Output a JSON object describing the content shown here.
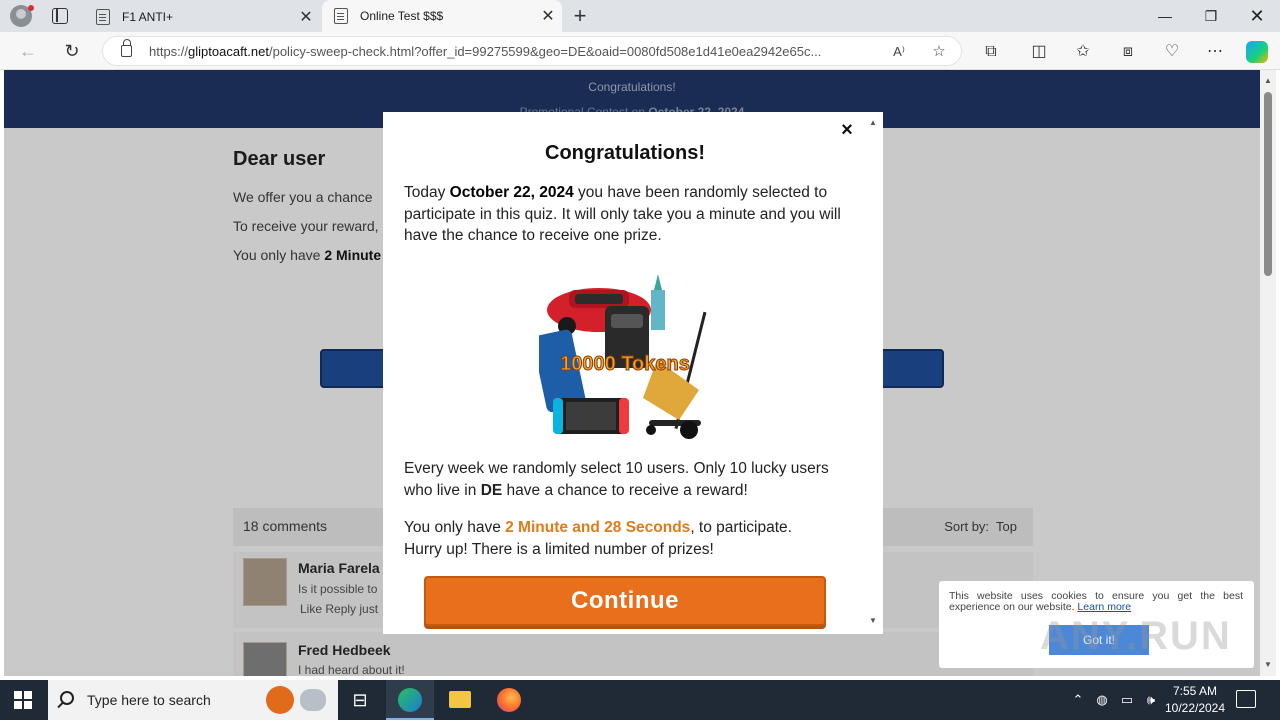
{
  "browser": {
    "tabs": [
      {
        "title": "F1 ANTI+",
        "close": "✕"
      },
      {
        "title": "Online Test $$$",
        "close": "✕"
      }
    ],
    "new_tab": "+",
    "window": {
      "minimize": "—",
      "maximize": "❐",
      "close": "✕"
    },
    "url_domain": "gliptoacaft.net",
    "url_prefix": "https://",
    "url_rest": "/policy-sweep-check.html?offer_id=99275599&geo=DE&oaid=0080fd508e1d41e0ea2942e65c..."
  },
  "page": {
    "header_line1": "Congratulations!",
    "header_line2_prefix": "Promotional Contest on ",
    "header_line2_date": "October 22, 2024",
    "dear": "Dear user",
    "line1": "We offer you a chance",
    "line2": "To receive your reward,",
    "line3_prefix": "You only have ",
    "line3_bold": "2 Minute",
    "comments_count": "18 comments",
    "sort_label": "Sort by:",
    "sort_value": "Top",
    "comments": [
      {
        "name": "Maria Farela",
        "text": "Is it possible to",
        "actions": "Like Reply  just"
      },
      {
        "name": "Fred Hedbeek",
        "text": "I had heard about it!"
      }
    ]
  },
  "modal": {
    "close": "×",
    "title": "Congratulations!",
    "p1_a": "Today ",
    "p1_date": "October 22, 2024",
    "p1_b": " you have been randomly selected to participate in this quiz. It will only take you a minute and you will have the chance to receive one prize.",
    "prize_text": "10000 Tokens",
    "p2_a": "Every week we randomly select 10 users. Only 10 lucky users who live in ",
    "p2_geo": "DE",
    "p2_b": " have a chance to receive a reward!",
    "p3_a": "You only have ",
    "p3_timer": "2 Minute and 28 Seconds",
    "p3_b": ", to participate.",
    "p3_c": "Hurry up! There is a limited number of prizes!",
    "button": "Continue"
  },
  "cookie": {
    "text": "This website uses cookies to ensure you get the best experience on our website.",
    "learn_more": "Learn more",
    "button": "Got it!"
  },
  "watermark": "ANY.RUN",
  "taskbar": {
    "search_placeholder": "Type here to search",
    "time": "7:55 AM",
    "date": "10/22/2024"
  },
  "colors": {
    "header_navy": "#1a2b54",
    "accent_orange": "#e8701c",
    "timer_orange": "#e07b1a",
    "cookie_button": "#4d88d8"
  }
}
